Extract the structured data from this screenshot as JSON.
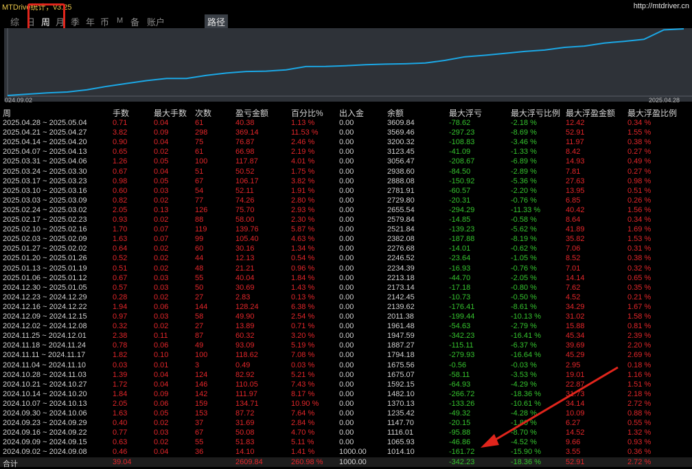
{
  "header": {
    "app_title": "MTDrive统计，v3.25",
    "site_link": "http://mtdriver.cn",
    "tabs": [
      "综",
      "日",
      "周",
      "月",
      "季",
      "年",
      "币",
      "M",
      "备",
      "账户"
    ],
    "path_tab": "路径"
  },
  "chart_data": {
    "type": "line",
    "x_start_label": "024.09.02",
    "x_end_label": "2025.04.28",
    "values": [
      1014.1,
      1065.93,
      1116.01,
      1147.7,
      1235.42,
      1370.13,
      1482.1,
      1592.15,
      1675.07,
      1675.56,
      1794.18,
      1887.27,
      1947.59,
      1961.48,
      2011.38,
      2139.62,
      2142.45,
      2173.14,
      2213.18,
      2234.39,
      2246.52,
      2276.68,
      2382.08,
      2521.84,
      2579.84,
      2655.54,
      2729.8,
      2781.91,
      2888.08,
      2938.6,
      3056.47,
      3123.45,
      3200.32,
      3569.46,
      3609.84
    ],
    "line_color": "#1ba8e6"
  },
  "table": {
    "headers": [
      "周",
      "手数",
      "最大手数",
      "次数",
      "盈亏金额",
      "百分比%",
      "出入金",
      "余额",
      "最大浮亏",
      "最大浮亏比例",
      "最大浮盈金额",
      "最大浮盈比例"
    ],
    "rows": [
      [
        "2025.04.28 ~ 2025.05.04",
        "0.71",
        "0.04",
        "61",
        "40.38",
        "1.13 %",
        "0.00",
        "3609.84",
        "-78.62",
        "-2.18 %",
        "12.42",
        "0.34 %"
      ],
      [
        "2025.04.21 ~ 2025.04.27",
        "3.82",
        "0.09",
        "298",
        "369.14",
        "11.53 %",
        "0.00",
        "3569.46",
        "-297.23",
        "-8.69 %",
        "52.91",
        "1.55 %"
      ],
      [
        "2025.04.14 ~ 2025.04.20",
        "0.90",
        "0.04",
        "75",
        "76.87",
        "2.46 %",
        "0.00",
        "3200.32",
        "-108.83",
        "-3.46 %",
        "11.97",
        "0.38 %"
      ],
      [
        "2025.04.07 ~ 2025.04.13",
        "0.65",
        "0.02",
        "61",
        "66.98",
        "2.19 %",
        "0.00",
        "3123.45",
        "-41.09",
        "-1.33 %",
        "8.42",
        "0.27 %"
      ],
      [
        "2025.03.31 ~ 2025.04.06",
        "1.26",
        "0.05",
        "100",
        "117.87",
        "4.01 %",
        "0.00",
        "3056.47",
        "-208.67",
        "-6.89 %",
        "14.93",
        "0.49 %"
      ],
      [
        "2025.03.24 ~ 2025.03.30",
        "0.67",
        "0.04",
        "51",
        "50.52",
        "1.75 %",
        "0.00",
        "2938.60",
        "-84.50",
        "-2.89 %",
        "7.81",
        "0.27 %"
      ],
      [
        "2025.03.17 ~ 2025.03.23",
        "0.98",
        "0.05",
        "67",
        "106.17",
        "3.82 %",
        "0.00",
        "2888.08",
        "-150.92",
        "-5.36 %",
        "27.63",
        "0.98 %"
      ],
      [
        "2025.03.10 ~ 2025.03.16",
        "0.60",
        "0.03",
        "54",
        "52.11",
        "1.91 %",
        "0.00",
        "2781.91",
        "-60.57",
        "-2.20 %",
        "13.95",
        "0.51 %"
      ],
      [
        "2025.03.03 ~ 2025.03.09",
        "0.82",
        "0.02",
        "77",
        "74.26",
        "2.80 %",
        "0.00",
        "2729.80",
        "-20.31",
        "-0.76 %",
        "6.85",
        "0.26 %"
      ],
      [
        "2025.02.24 ~ 2025.03.02",
        "2.05",
        "0.13",
        "126",
        "75.70",
        "2.93 %",
        "0.00",
        "2655.54",
        "-294.29",
        "-11.33 %",
        "40.42",
        "1.56 %"
      ],
      [
        "2025.02.17 ~ 2025.02.23",
        "0.93",
        "0.02",
        "88",
        "58.00",
        "2.30 %",
        "0.00",
        "2579.84",
        "-14.85",
        "-0.58 %",
        "8.64",
        "0.34 %"
      ],
      [
        "2025.02.10 ~ 2025.02.16",
        "1.70",
        "0.07",
        "119",
        "139.76",
        "5.87 %",
        "0.00",
        "2521.84",
        "-139.23",
        "-5.62 %",
        "41.89",
        "1.69 %"
      ],
      [
        "2025.02.03 ~ 2025.02.09",
        "1.63",
        "0.07",
        "99",
        "105.40",
        "4.63 %",
        "0.00",
        "2382.08",
        "-187.88",
        "-8.19 %",
        "35.82",
        "1.53 %"
      ],
      [
        "2025.01.27 ~ 2025.02.02",
        "0.64",
        "0.02",
        "60",
        "30.16",
        "1.34 %",
        "0.00",
        "2276.68",
        "-14.01",
        "-0.62 %",
        "7.06",
        "0.31 %"
      ],
      [
        "2025.01.20 ~ 2025.01.26",
        "0.52",
        "0.02",
        "44",
        "12.13",
        "0.54 %",
        "0.00",
        "2246.52",
        "-23.64",
        "-1.05 %",
        "8.52",
        "0.38 %"
      ],
      [
        "2025.01.13 ~ 2025.01.19",
        "0.51",
        "0.02",
        "48",
        "21.21",
        "0.96 %",
        "0.00",
        "2234.39",
        "-16.93",
        "-0.76 %",
        "7.01",
        "0.32 %"
      ],
      [
        "2025.01.06 ~ 2025.01.12",
        "0.67",
        "0.03",
        "55",
        "40.04",
        "1.84 %",
        "0.00",
        "2213.18",
        "-44.70",
        "-2.05 %",
        "14.14",
        "0.65 %"
      ],
      [
        "2024.12.30 ~ 2025.01.05",
        "0.57",
        "0.03",
        "50",
        "30.69",
        "1.43 %",
        "0.00",
        "2173.14",
        "-17.18",
        "-0.80 %",
        "7.62",
        "0.35 %"
      ],
      [
        "2024.12.23 ~ 2024.12.29",
        "0.28",
        "0.02",
        "27",
        "2.83",
        "0.13 %",
        "0.00",
        "2142.45",
        "-10.73",
        "-0.50 %",
        "4.52",
        "0.21 %"
      ],
      [
        "2024.12.16 ~ 2024.12.22",
        "1.94",
        "0.06",
        "144",
        "128.24",
        "6.38 %",
        "0.00",
        "2139.62",
        "-176.41",
        "-8.61 %",
        "34.29",
        "1.67 %"
      ],
      [
        "2024.12.09 ~ 2024.12.15",
        "0.97",
        "0.03",
        "58",
        "49.90",
        "2.54 %",
        "0.00",
        "2011.38",
        "-199.44",
        "-10.13 %",
        "31.02",
        "1.58 %"
      ],
      [
        "2024.12.02 ~ 2024.12.08",
        "0.32",
        "0.02",
        "27",
        "13.89",
        "0.71 %",
        "0.00",
        "1961.48",
        "-54.63",
        "-2.79 %",
        "15.88",
        "0.81 %"
      ],
      [
        "2024.11.25 ~ 2024.12.01",
        "2.38",
        "0.11",
        "87",
        "60.32",
        "3.20 %",
        "0.00",
        "1947.59",
        "-342.23",
        "-16.41 %",
        "45.34",
        "2.39 %"
      ],
      [
        "2024.11.18 ~ 2024.11.24",
        "0.78",
        "0.06",
        "49",
        "93.09",
        "5.19 %",
        "0.00",
        "1887.27",
        "-115.11",
        "-6.37 %",
        "39.69",
        "2.20 %"
      ],
      [
        "2024.11.11 ~ 2024.11.17",
        "1.82",
        "0.10",
        "100",
        "118.62",
        "7.08 %",
        "0.00",
        "1794.18",
        "-279.93",
        "-16.64 %",
        "45.29",
        "2.69 %"
      ],
      [
        "2024.11.04 ~ 2024.11.10",
        "0.03",
        "0.01",
        "3",
        "0.49",
        "0.03 %",
        "0.00",
        "1675.56",
        "-0.56",
        "-0.03 %",
        "2.95",
        "0.18 %"
      ],
      [
        "2024.10.28 ~ 2024.11.03",
        "1.39",
        "0.04",
        "124",
        "82.92",
        "5.21 %",
        "0.00",
        "1675.07",
        "-58.11",
        "-3.53 %",
        "19.01",
        "1.16 %"
      ],
      [
        "2024.10.21 ~ 2024.10.27",
        "1.72",
        "0.04",
        "146",
        "110.05",
        "7.43 %",
        "0.00",
        "1592.15",
        "-64.93",
        "-4.29 %",
        "22.87",
        "1.51 %"
      ],
      [
        "2024.10.14 ~ 2024.10.20",
        "1.84",
        "0.09",
        "142",
        "111.97",
        "8.17 %",
        "0.00",
        "1482.10",
        "-266.72",
        "-18.36 %",
        "31.73",
        "2.18 %"
      ],
      [
        "2024.10.07 ~ 2024.10.13",
        "2.05",
        "0.06",
        "159",
        "134.71",
        "10.90 %",
        "0.00",
        "1370.13",
        "-133.26",
        "-10.61 %",
        "34.14",
        "2.72 %"
      ],
      [
        "2024.09.30 ~ 2024.10.06",
        "1.63",
        "0.05",
        "153",
        "87.72",
        "7.64 %",
        "0.00",
        "1235.42",
        "-49.32",
        "-4.28 %",
        "10.09",
        "0.88 %"
      ],
      [
        "2024.09.23 ~ 2024.09.29",
        "0.40",
        "0.02",
        "37",
        "31.69",
        "2.84 %",
        "0.00",
        "1147.70",
        "-20.15",
        "-1.80 %",
        "6.27",
        "0.55 %"
      ],
      [
        "2024.09.16 ~ 2024.09.22",
        "0.77",
        "0.03",
        "67",
        "50.08",
        "4.70 %",
        "0.00",
        "1116.01",
        "-95.88",
        "-8.70 %",
        "14.52",
        "1.32 %"
      ],
      [
        "2024.09.09 ~ 2024.09.15",
        "0.63",
        "0.02",
        "55",
        "51.83",
        "5.11 %",
        "0.00",
        "1065.93",
        "-46.86",
        "-4.52 %",
        "9.66",
        "0.93 %"
      ],
      [
        "2024.09.02 ~ 2024.09.08",
        "0.46",
        "0.04",
        "36",
        "14.10",
        "1.41 %",
        "1000.00",
        "1014.10",
        "-161.72",
        "-15.90 %",
        "3.55",
        "0.36 %"
      ]
    ],
    "total": [
      "合计",
      "39.04",
      "",
      "",
      "2609.84",
      "260.98 %",
      "1000.00",
      "",
      "-342.23",
      "-18.36 %",
      "52.91",
      "2.72 %"
    ]
  },
  "colors": {
    "red": "#e3262a",
    "green": "#35c42e",
    "gold": "#e8c54a",
    "annotation": "#e0251c"
  }
}
